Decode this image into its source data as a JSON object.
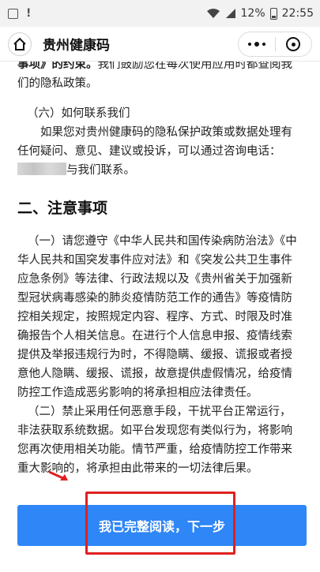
{
  "status_bar": {
    "signal": "12%",
    "time": "22:55"
  },
  "title_bar": {
    "title": "贵州健康码",
    "home_icon": "home-icon",
    "more_icon": "more-dots-icon",
    "close_icon": "target-circle-icon"
  },
  "content": {
    "cut_line_bold": "事项》的约束。",
    "cut_line_rest": "我们鼓励您在每次使用应用时都查阅我",
    "cut_line_2": "们的隐私政策。",
    "contact_heading": "（六）如何联系我们",
    "contact_text_1": "如果您对贵州健康码的隐私保护政策或数据处理有任何疑问、意见、建议或投诉，可以通过咨询电话：",
    "contact_text_2": "与我们联系。",
    "section_heading": "二、注意事项",
    "item_1": "（一）请您遵守《中华人民共和国传染病防治法》《中华人民共和国突发事件应对法》和《突发公共卫生事件应急条例》等法律、行政法规以及《贵州省关于加强新型冠状病毒感染的肺炎疫情防范工作的通告》等疫情防控相关规定，按照规定内容、程序、方式、时限及时准确报告个人相关信息。在进行个人信息申报、疫情线索提供及举报违规行为时，不得隐瞒、缓报、谎报或者授意他人隐瞒、缓报、谎报，故意提供虚假情况，给疫情防控工作造成恶劣影响的将承担相应法律责任。",
    "item_2": "（二）禁止采用任何恶意手段，干扰平台正常运行，非法获取系统数据。如平台发现您有类似行为，将影响您再次使用相关功能。情节严重，给疫情防控工作带来重大影响的，将承担由此带来的一切法律后果。"
  },
  "footer": {
    "confirm_label": "我已完整阅读，下一步"
  },
  "colors": {
    "button": "#2f86f6",
    "highlight": "#e02020"
  }
}
